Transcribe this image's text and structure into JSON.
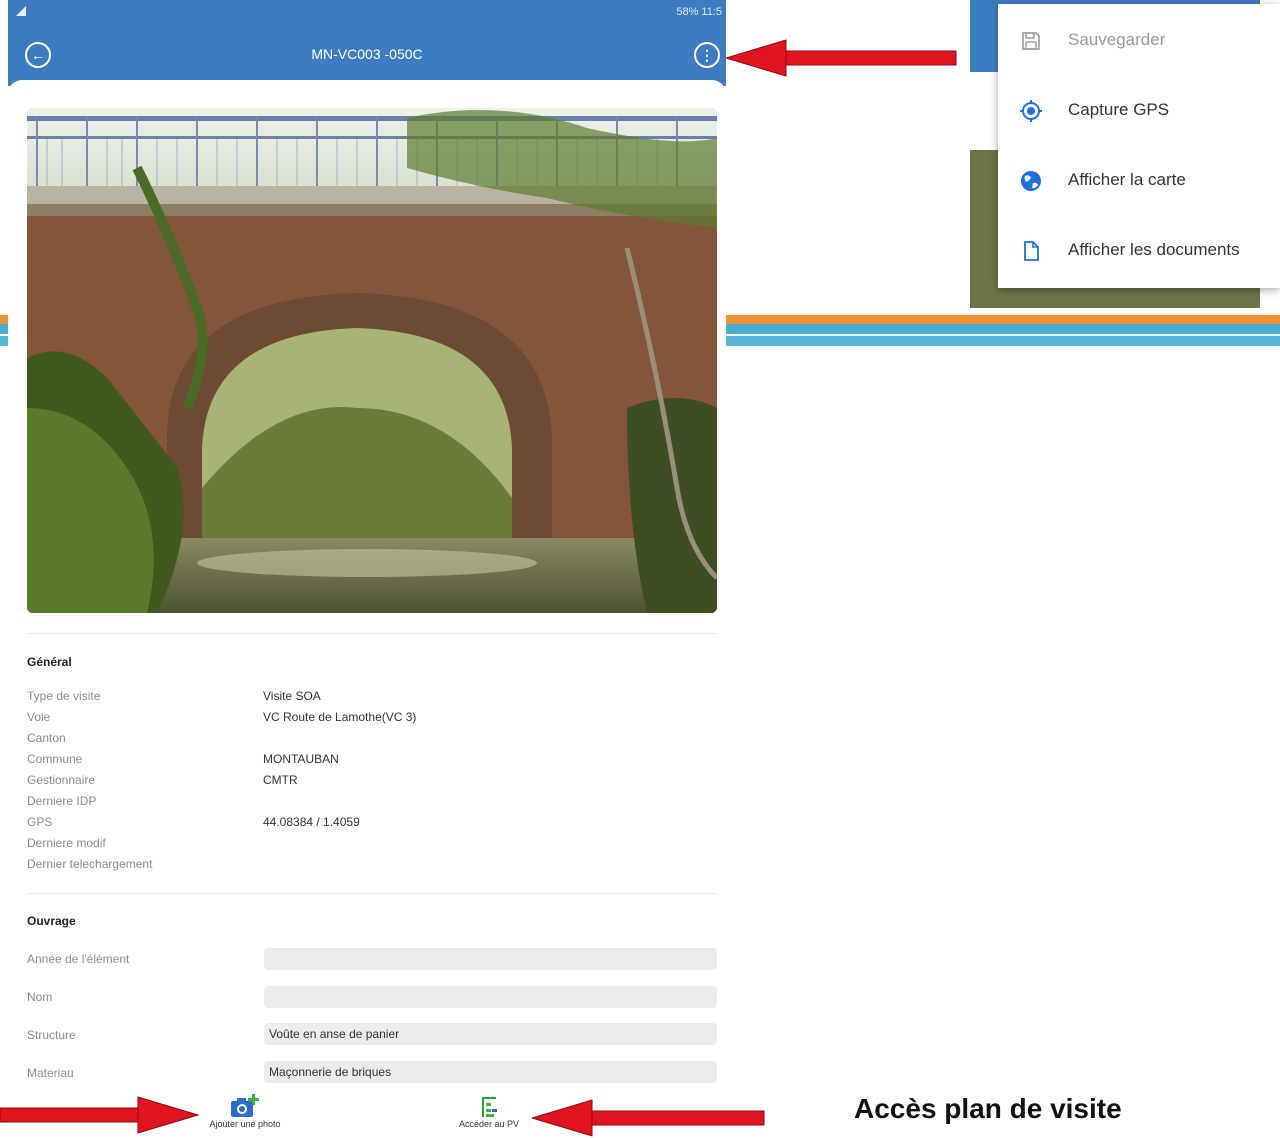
{
  "status_bar": {
    "right_text": "58% 11:5"
  },
  "app_bar": {
    "title": "MN-VC003 -050C"
  },
  "general": {
    "title": "Général",
    "rows": [
      {
        "label": "Type de visite",
        "value": "Visite SOA"
      },
      {
        "label": "Voie",
        "value": "VC Route de Lamothe(VC 3)"
      },
      {
        "label": "Canton",
        "value": ""
      },
      {
        "label": "Commune",
        "value": "MONTAUBAN"
      },
      {
        "label": "Gestionnaire",
        "value": "CMTR"
      },
      {
        "label": "Derniere IDP",
        "value": ""
      },
      {
        "label": "GPS",
        "value": "44.08384 / 1.4059"
      },
      {
        "label": "Derniere modif",
        "value": ""
      },
      {
        "label": "Dernier telechargement",
        "value": ""
      }
    ]
  },
  "ouvrage": {
    "title": "Ouvrage",
    "rows": [
      {
        "label": "Année de l'élément",
        "value": ""
      },
      {
        "label": "Nom",
        "value": ""
      },
      {
        "label": "Structure",
        "value": "Voûte en anse de panier"
      },
      {
        "label": "Materiau",
        "value": "Maçonnerie de briques"
      }
    ]
  },
  "bottom_bar": {
    "add_photo_label": "Ajouter une photo",
    "access_pv_label": "Accéder au PV"
  },
  "menu": {
    "items": [
      {
        "label": "Sauvegarder",
        "icon": "save-icon",
        "enabled": false
      },
      {
        "label": "Capture GPS",
        "icon": "gps-target-icon",
        "enabled": true
      },
      {
        "label": "Afficher la carte",
        "icon": "globe-icon",
        "enabled": true
      },
      {
        "label": "Afficher les documents",
        "icon": "document-icon",
        "enabled": true
      }
    ]
  },
  "caption": "Accès plan de visite",
  "colors": {
    "app_bar": "#3e7cc2",
    "arrow": "#e0141e",
    "accent_icon": "#1e6fd9",
    "stripe_orange": "#f0923c",
    "stripe_blue": "#4aaed0"
  }
}
